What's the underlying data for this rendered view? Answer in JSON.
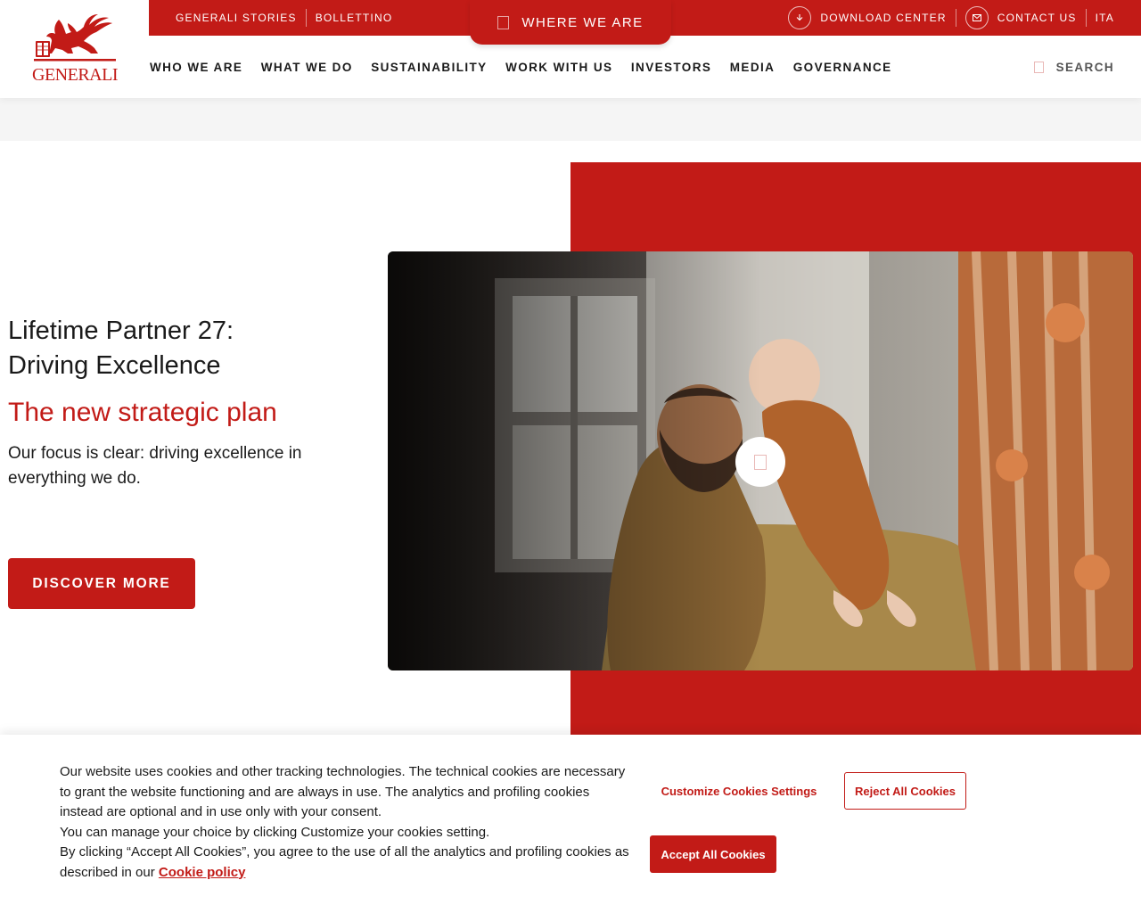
{
  "brand": {
    "name": "GENERALI",
    "color": "#c21b17"
  },
  "topbar": {
    "left_links": [
      "GENERALI STORIES",
      "BOLLETTINO"
    ],
    "where_we_are": "WHERE WE ARE",
    "download_center": "DOWNLOAD CENTER",
    "contact_us": "CONTACT US",
    "language": "ITA"
  },
  "nav": {
    "items": [
      "WHO WE ARE",
      "WHAT WE DO",
      "SUSTAINABILITY",
      "WORK WITH US",
      "INVESTORS",
      "MEDIA",
      "GOVERNANCE"
    ],
    "search_label": "SEARCH"
  },
  "hero": {
    "title": "Lifetime Partner 27: Driving Excellence",
    "subtitle": "The new strategic plan",
    "description": "Our focus is clear: driving excellence in everything we do.",
    "cta": "DISCOVER MORE",
    "media_icon": "play-icon"
  },
  "cookie_banner": {
    "text_p1": "Our website uses cookies and other tracking technologies. The technical cookies are necessary to grant the website functioning and are always in use. The analytics and profiling cookies instead are optional and in use only with your consent.",
    "text_p2": "You can manage your choice by clicking Customize your cookies setting.",
    "text_p3": "By clicking “Accept All Cookies”, you agree to the use of all the analytics and profiling cookies as described in our ",
    "policy_link": "Cookie policy",
    "customize_label": "Customize Cookies Settings",
    "reject_label": "Reject All Cookies",
    "accept_label": "Accept All Cookies"
  }
}
